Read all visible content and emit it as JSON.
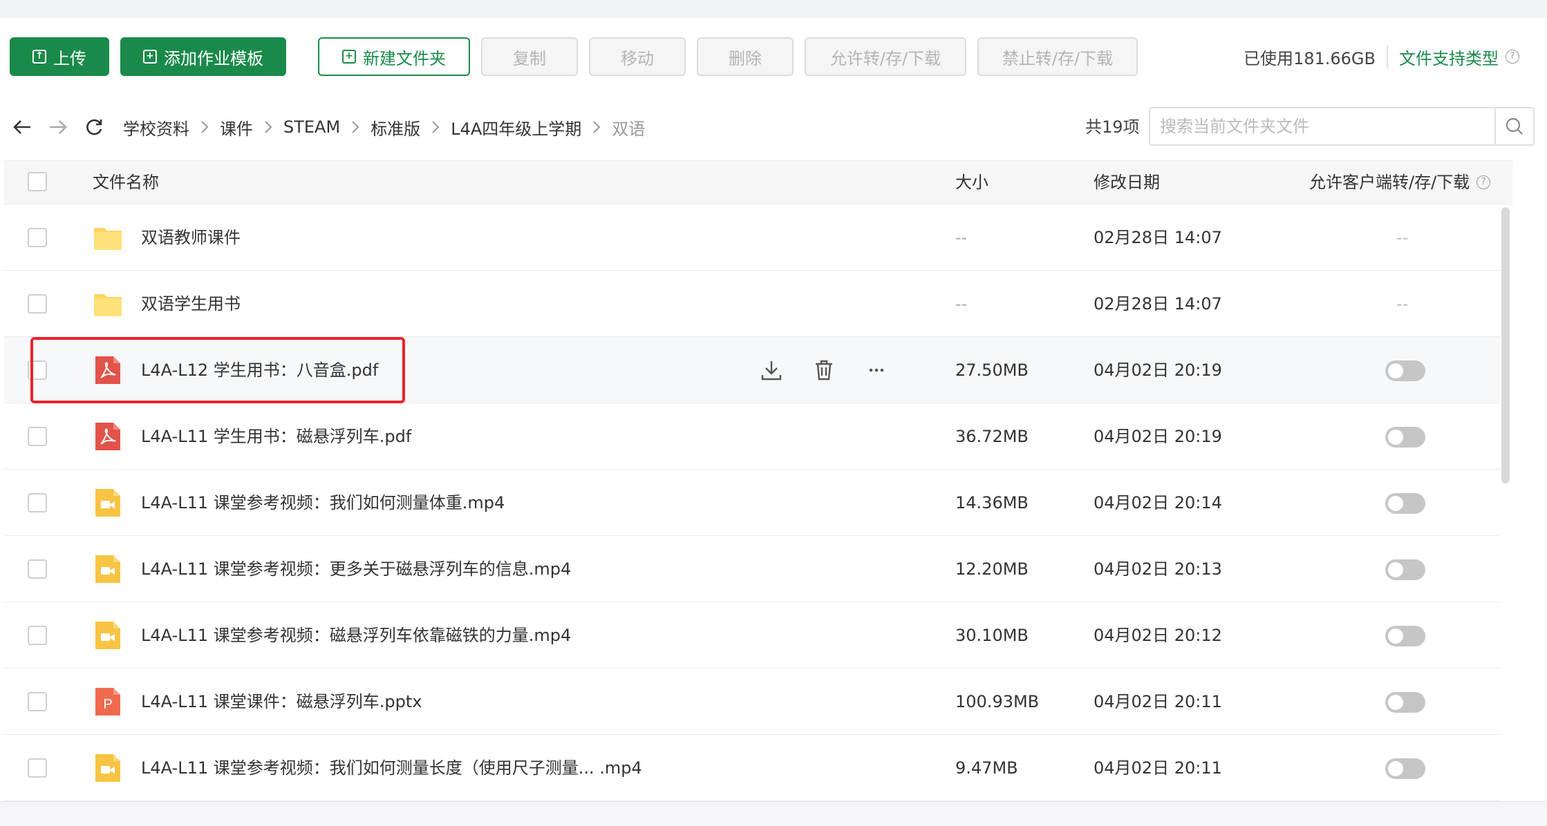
{
  "toolbar": {
    "upload": "上传",
    "add_template": "添加作业模板",
    "new_folder": "新建文件夹",
    "copy": "复制",
    "move": "移动",
    "delete": "删除",
    "allow": "允许转/存/下载",
    "forbid": "禁止转/存/下载"
  },
  "usage": {
    "used": "已使用181.66GB",
    "types": "文件支持类型"
  },
  "breadcrumb": [
    "学校资料",
    "课件",
    "STEAM",
    "标准版",
    "L4A四年级上学期",
    "双语"
  ],
  "count": "共19项",
  "search": {
    "placeholder": "搜索当前文件夹文件"
  },
  "columns": {
    "name": "文件名称",
    "size": "大小",
    "date": "修改日期",
    "allow": "允许客户端转/存/下载"
  },
  "rows": [
    {
      "type": "folder",
      "name": "双语教师课件",
      "size": "--",
      "date": "02月28日 14:07",
      "allow": "--"
    },
    {
      "type": "folder",
      "name": "双语学生用书",
      "size": "--",
      "date": "02月28日 14:07",
      "allow": "--"
    },
    {
      "type": "pdf",
      "name": "L4A-L12 学生用书：八音盒.pdf",
      "size": "27.50MB",
      "date": "04月02日 20:19",
      "allow": "off"
    },
    {
      "type": "pdf",
      "name": "L4A-L11 学生用书：磁悬浮列车.pdf",
      "size": "36.72MB",
      "date": "04月02日 20:19",
      "allow": "off"
    },
    {
      "type": "video",
      "name": "L4A-L11 课堂参考视频：我们如何测量体重.mp4",
      "size": "14.36MB",
      "date": "04月02日 20:14",
      "allow": "off"
    },
    {
      "type": "video",
      "name": "L4A-L11 课堂参考视频：更多关于磁悬浮列车的信息.mp4",
      "size": "12.20MB",
      "date": "04月02日 20:13",
      "allow": "off"
    },
    {
      "type": "video",
      "name": "L4A-L11 课堂参考视频：磁悬浮列车依靠磁铁的力量.mp4",
      "size": "30.10MB",
      "date": "04月02日 20:12",
      "allow": "off"
    },
    {
      "type": "ppt",
      "name": "L4A-L11 课堂课件：磁悬浮列车.pptx",
      "size": "100.93MB",
      "date": "04月02日 20:11",
      "allow": "off"
    },
    {
      "type": "video",
      "name": "L4A-L11 课堂参考视频：我们如何测量长度（使用尺子测量... .mp4",
      "size": "9.47MB",
      "date": "04月02日 20:11",
      "allow": "off"
    }
  ],
  "colors": {
    "primary": "#1a8a4a",
    "folder": "#ffd75e",
    "pdf": "#e2534a",
    "video": "#f8c444",
    "ppt": "#ef6a4d",
    "highlight": "#e8232b"
  },
  "icons": {
    "ppt_letter": "P"
  }
}
